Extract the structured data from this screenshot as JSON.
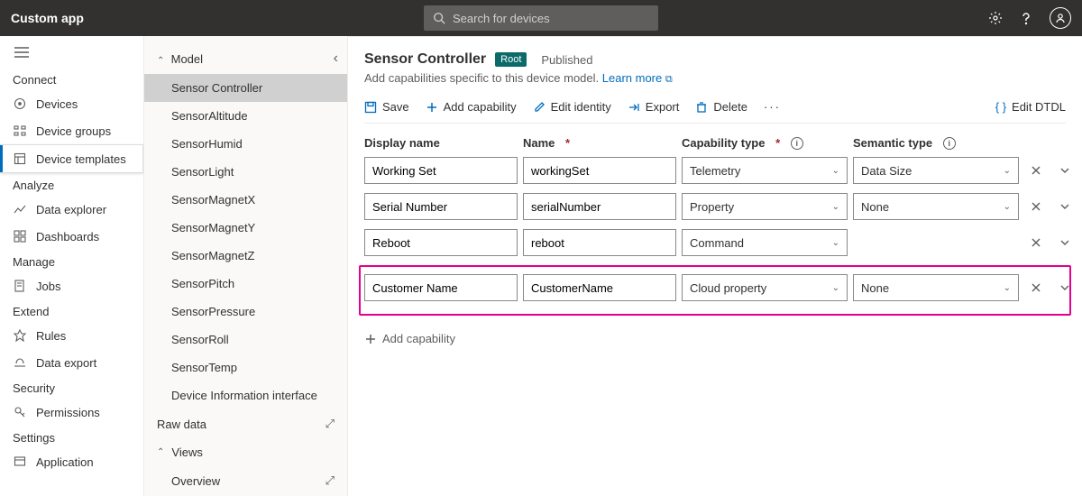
{
  "header": {
    "app_title": "Custom app",
    "search_placeholder": "Search for devices"
  },
  "sidebar": {
    "connect": "Connect",
    "devices": "Devices",
    "device_groups": "Device groups",
    "device_templates": "Device templates",
    "analyze": "Analyze",
    "data_explorer": "Data explorer",
    "dashboards": "Dashboards",
    "manage": "Manage",
    "jobs": "Jobs",
    "extend": "Extend",
    "rules": "Rules",
    "data_export": "Data export",
    "security": "Security",
    "permissions": "Permissions",
    "settings": "Settings",
    "application": "Application"
  },
  "model_panel": {
    "model": "Model",
    "items": [
      "Sensor Controller",
      "SensorAltitude",
      "SensorHumid",
      "SensorLight",
      "SensorMagnetX",
      "SensorMagnetY",
      "SensorMagnetZ",
      "SensorPitch",
      "SensorPressure",
      "SensorRoll",
      "SensorTemp",
      "Device Information interface"
    ],
    "raw_data": "Raw data",
    "views": "Views",
    "overview": "Overview"
  },
  "main": {
    "title": "Sensor Controller",
    "root_badge": "Root",
    "status": "Published",
    "desc": "Add capabilities specific to this device model. ",
    "learn_more": "Learn more",
    "toolbar": {
      "save": "Save",
      "add_cap": "Add capability",
      "edit_identity": "Edit identity",
      "export": "Export",
      "delete": "Delete",
      "edit_dtdl": "Edit DTDL"
    },
    "columns": {
      "display_name": "Display name",
      "name": "Name",
      "cap_type": "Capability type",
      "sem_type": "Semantic type"
    },
    "rows": [
      {
        "display": "Working Set",
        "name": "workingSet",
        "type": "Telemetry",
        "sem": "Data Size",
        "type_has_dropdown": true,
        "sem_visible": true
      },
      {
        "display": "Serial Number",
        "name": "serialNumber",
        "type": "Property",
        "sem": "None",
        "type_has_dropdown": true,
        "sem_visible": true
      },
      {
        "display": "Reboot",
        "name": "reboot",
        "type": "Command",
        "sem": "",
        "type_has_dropdown": true,
        "sem_visible": false
      },
      {
        "display": "Customer Name",
        "name": "CustomerName",
        "type": "Cloud property",
        "sem": "None",
        "type_has_dropdown": true,
        "sem_visible": true
      }
    ],
    "add_cap_inline": "Add capability"
  }
}
